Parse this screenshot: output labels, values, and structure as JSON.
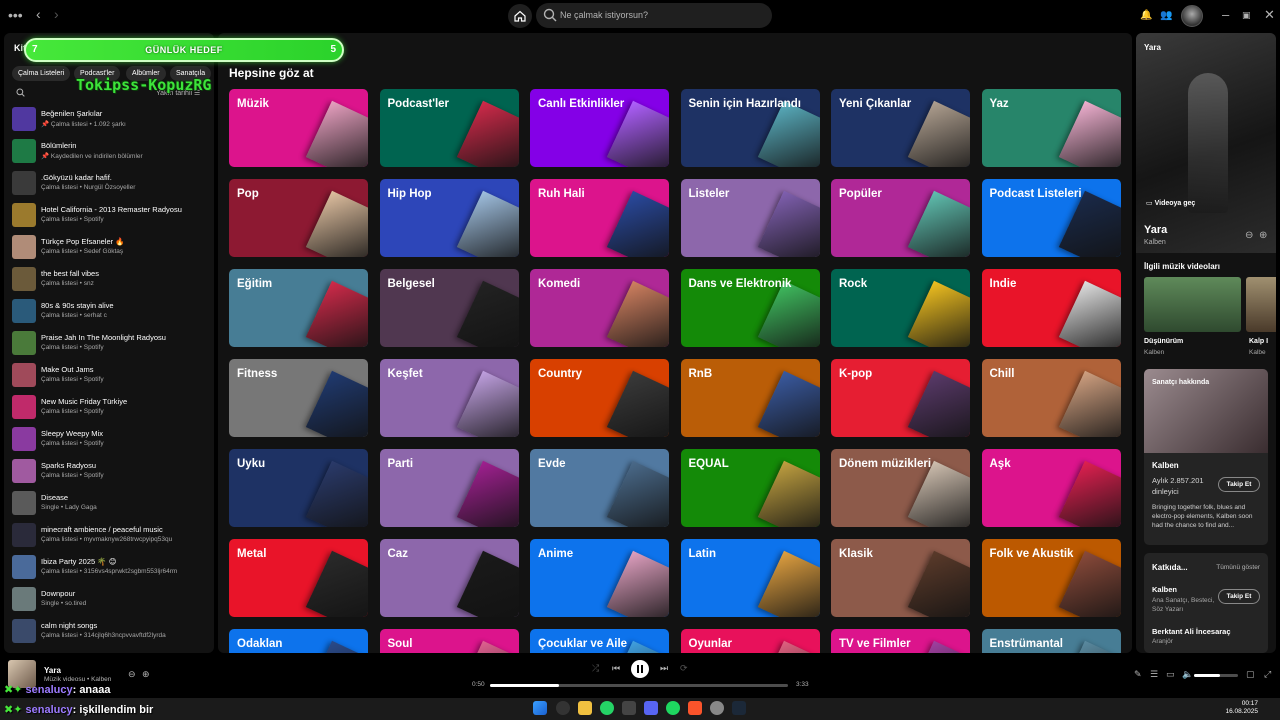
{
  "topbar": {
    "search_placeholder": "Ne çalmak istiyorsun?"
  },
  "overlay": {
    "goal_label": "GÜNLÜK HEDEF",
    "goal_current": "7",
    "goal_target": "5",
    "tag": "Tokipss-KopuzRG"
  },
  "sidebar": {
    "title": "Kit",
    "chips": [
      "Çalma Listeleri",
      "Podcast'ler",
      "Albümler",
      "Sanatçıla"
    ],
    "sort_label": "Yakın tarihli",
    "items": [
      {
        "name": "Beğenilen Şarkılar",
        "sub": "📌 Çalma listesi • 1.092 şarkı",
        "color": "#5038a0"
      },
      {
        "name": "Bölümlerin",
        "sub": "📌 Kaydedilen ve indirilen bölümler",
        "color": "#1e7a45"
      },
      {
        "name": ".Gökyüzü kadar hafif.",
        "sub": "Çalma listesi • Nurgül Özsoyeller",
        "color": "#3a3a3a"
      },
      {
        "name": "Hotel California - 2013 Remaster Radyosu",
        "sub": "Çalma listesi • Spotify",
        "color": "#9b7a2d"
      },
      {
        "name": "Türkçe Pop Efsaneler 🔥",
        "sub": "Çalma listesi • Sedef Göktaş",
        "color": "#b08c78"
      },
      {
        "name": "the best fall vibes",
        "sub": "Çalma listesi • snz",
        "color": "#6b5a3a"
      },
      {
        "name": "80s & 90s stayin alive",
        "sub": "Çalma listesi • serhat c",
        "color": "#2a5a7a"
      },
      {
        "name": "Praise Jah In The Moonlight Radyosu",
        "sub": "Çalma listesi • Spotify",
        "color": "#4a7a3a"
      },
      {
        "name": "Make Out Jams",
        "sub": "Çalma listesi • Spotify",
        "color": "#a04a5a"
      },
      {
        "name": "New Music Friday Türkiye",
        "sub": "Çalma listesi • Spotify",
        "color": "#c02a6a"
      },
      {
        "name": "Sleepy Weepy Mix",
        "sub": "Çalma listesi • Spotify",
        "color": "#8a3aa0"
      },
      {
        "name": "Sparks Radyosu",
        "sub": "Çalma listesi • Spotify",
        "color": "#a05aa0"
      },
      {
        "name": "Disease",
        "sub": "Single • Lady Gaga",
        "color": "#5a5a5a"
      },
      {
        "name": "minecraft ambience / peaceful music",
        "sub": "Çalma listesi • myvmaknyw268trwcpyipq53qu",
        "color": "#2a2a3a"
      },
      {
        "name": "Ibiza Party 2025 🌴 😊",
        "sub": "Çalma listesi • 3156vs4sprwkt2sgbm553ljr64rm",
        "color": "#4a6a9a"
      },
      {
        "name": "Downpour",
        "sub": "Single • so.tired",
        "color": "#6a7a7a"
      },
      {
        "name": "calm night songs",
        "sub": "Çalma listesi • 314cjlq6h3ncpvvavftdf2lyrda",
        "color": "#3a4a6a"
      }
    ]
  },
  "main": {
    "title": "Hepsine göz at",
    "tiles": [
      {
        "label": "Müzik",
        "bg": "#dc148c",
        "art": "#e8a0c0"
      },
      {
        "label": "Podcast'ler",
        "bg": "#006450",
        "art": "#d02a4a"
      },
      {
        "label": "Canlı Etkinlikler",
        "bg": "#8400e7",
        "art": "#b060ff"
      },
      {
        "label": "Senin için Hazırlandı",
        "bg": "#1e3264",
        "art": "#5ab0c0"
      },
      {
        "label": "Yeni Çıkanlar",
        "bg": "#1e3264",
        "art": "#b0a090"
      },
      {
        "label": "Yaz",
        "bg": "#27856a",
        "art": "#f0b0d0"
      },
      {
        "label": "Pop",
        "bg": "#8d1932",
        "art": "#e0c0a0"
      },
      {
        "label": "Hip Hop",
        "bg": "#2d46b9",
        "art": "#a0c0e0"
      },
      {
        "label": "Ruh Hali",
        "bg": "#dc148c",
        "art": "#2a4aa0"
      },
      {
        "label": "Listeler",
        "bg": "#8d67ab",
        "art": "#8060b0"
      },
      {
        "label": "Popüler",
        "bg": "#b02897",
        "art": "#60c0b0"
      },
      {
        "label": "Podcast Listeleri",
        "bg": "#0d73ec",
        "art": "#1a2a4a"
      },
      {
        "label": "Eğitim",
        "bg": "#477d95",
        "art": "#d02a4a"
      },
      {
        "label": "Belgesel",
        "bg": "#503750",
        "art": "#222222"
      },
      {
        "label": "Komedi",
        "bg": "#af2896",
        "art": "#d08060"
      },
      {
        "label": "Dans ve Elektronik",
        "bg": "#148a08",
        "art": "#40c060"
      },
      {
        "label": "Rock",
        "bg": "#006450",
        "art": "#f0c020"
      },
      {
        "label": "Indie",
        "bg": "#e91429",
        "art": "#e0e0e0"
      },
      {
        "label": "Fitness",
        "bg": "#777777",
        "art": "#203a70"
      },
      {
        "label": "Keşfet",
        "bg": "#8d67ab",
        "art": "#c0a0e0"
      },
      {
        "label": "Country",
        "bg": "#d84000",
        "art": "#3a3a3a"
      },
      {
        "label": "RnB",
        "bg": "#ba5d07",
        "art": "#3a5aa0"
      },
      {
        "label": "K-pop",
        "bg": "#e61e32",
        "art": "#5a3a6a"
      },
      {
        "label": "Chill",
        "bg": "#b06239",
        "art": "#d0a080"
      },
      {
        "label": "Uyku",
        "bg": "#1e3264",
        "art": "#2a3a6a"
      },
      {
        "label": "Parti",
        "bg": "#8d67ab",
        "art": "#a02090"
      },
      {
        "label": "Evde",
        "bg": "#5179a1",
        "art": "#4a6a8a"
      },
      {
        "label": "EQUAL",
        "bg": "#148a08",
        "art": "#c0a040"
      },
      {
        "label": "Dönem müzikleri",
        "bg": "#8d5a4a",
        "art": "#d0c0b0"
      },
      {
        "label": "Aşk",
        "bg": "#dc148c",
        "art": "#e02050"
      },
      {
        "label": "Metal",
        "bg": "#e91429",
        "art": "#2a2a2a"
      },
      {
        "label": "Caz",
        "bg": "#8d67ab",
        "art": "#1a1a1a"
      },
      {
        "label": "Anime",
        "bg": "#0d73ec",
        "art": "#e0a0c0"
      },
      {
        "label": "Latin",
        "bg": "#0d73ec",
        "art": "#e0a040"
      },
      {
        "label": "Klasik",
        "bg": "#8d5a4a",
        "art": "#5a3a2a"
      },
      {
        "label": "Folk ve Akustik",
        "bg": "#bc5900",
        "art": "#8a4a3a"
      },
      {
        "label": "Odaklan",
        "bg": "#0d73ec",
        "art": "#2a4a8a"
      },
      {
        "label": "Soul",
        "bg": "#dc148c",
        "art": "#e06090"
      },
      {
        "label": "Çocuklar ve Aile",
        "bg": "#0d73ec",
        "art": "#40a0e0"
      },
      {
        "label": "Oyunlar",
        "bg": "#e8115b",
        "art": "#e06080"
      },
      {
        "label": "TV ve Filmler",
        "bg": "#dc148c",
        "art": "#a040a0"
      },
      {
        "label": "Enstrümantal",
        "bg": "#477d95",
        "art": "#5a8aa0"
      }
    ]
  },
  "rightpanel": {
    "header": "Yara",
    "videos_button": "Videoya geç",
    "song": "Yara",
    "artist": "Kalben",
    "related_title": "İlgili müzik videoları",
    "related": [
      {
        "title": "Düşünürüm",
        "sub": "Kalben"
      },
      {
        "title": "Kalp I",
        "sub": "Kalbe"
      }
    ],
    "about": {
      "title": "Sanatçı hakkında",
      "name": "Kalben",
      "listeners": "Aylık 2.857.201 dinleyici",
      "follow": "Takip Et",
      "bio": "Bringing together folk, blues and electro-pop elements, Kalben soon had the chance to find and..."
    },
    "credits": {
      "title": "Katkıda...",
      "show_all": "Tümünü göster",
      "people": [
        {
          "name": "Kalben",
          "role": "Ana Sanatçı, Besteci, Söz Yazarı",
          "follow": "Takip Et"
        },
        {
          "name": "Berktant Ali İncesaraç",
          "role": "Aranjör"
        }
      ]
    }
  },
  "player": {
    "title": "Yara",
    "subtitle": "Müzik videosu • Kalben",
    "current_time": "0:50",
    "total_time": "3:33",
    "progress_fraction": 0.23,
    "volume_fraction": 0.6
  },
  "chat": [
    {
      "user": "senalucy",
      "text": ": anaaa"
    },
    {
      "user": "senalucy",
      "text": ": işkillendim bir"
    }
  ],
  "taskbar": {
    "time": "00:17",
    "date": "16.08.2025"
  }
}
